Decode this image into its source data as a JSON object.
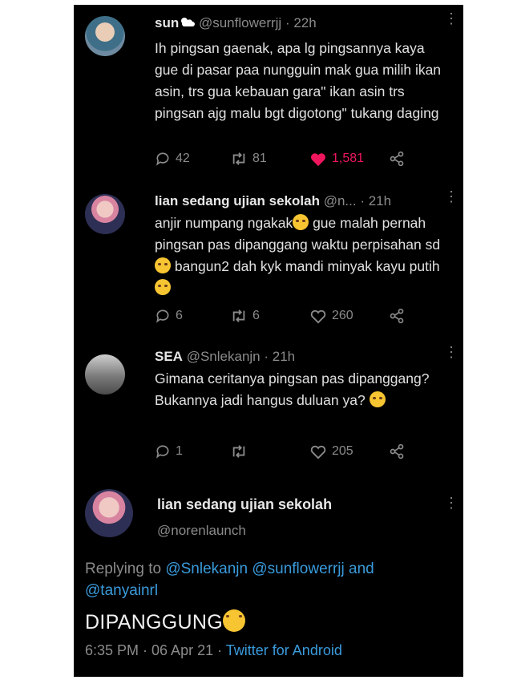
{
  "tweets": [
    {
      "name": "sun",
      "handle": "@sunflowerrjj",
      "time": "· 22h",
      "text": "Ih pingsan gaenak, apa lg pingsannya kaya gue di pasar paa nungguin mak gua milih ikan asin, trs gua kebauan gara\" ikan asin trs pingsan ajg malu bgt digotong\" tukang daging",
      "replies": "42",
      "retweets": "81",
      "likes": "1,581",
      "liked": true
    },
    {
      "name": "lian sedang ujian sekolah",
      "handle": "@n...",
      "time": "· 21h",
      "text_parts": [
        "anjir numpang ngakak",
        " gue malah pernah pingsan pas dipanggang waktu perpisahan sd",
        " bangun2 dah kyk mandi minyak kayu putih"
      ],
      "replies": "6",
      "retweets": "6",
      "likes": "260"
    },
    {
      "name": "SEA",
      "handle": "@Snlekanjn",
      "time": "· 21h",
      "text": "Gimana ceritanya pingsan pas dipanggang? Bukannya jadi hangus duluan ya?",
      "replies": "1",
      "retweets": "",
      "likes": "205"
    }
  ],
  "main": {
    "name": "lian sedang ujian sekolah",
    "handle": "@norenlaunch",
    "replying_prefix": "Replying to",
    "replying_to": "@Snlekanjn @sunflowerrjj and @tanyainrl",
    "text": "DIPANGGUNG",
    "timestamp": "6:35 PM · 06 Apr 21 ·",
    "source": "Twitter for Android"
  },
  "icons": {
    "reply": "reply-icon",
    "retweet": "retweet-icon",
    "like": "heart-icon",
    "share": "share-icon",
    "emoji": "loudly-crying-face-emoji",
    "weather": "sun-behind-cloud-emoji"
  },
  "colors": {
    "background": "#000000",
    "like": "#f0165d",
    "link": "#3a9bdc",
    "muted": "#8b8b8b"
  }
}
